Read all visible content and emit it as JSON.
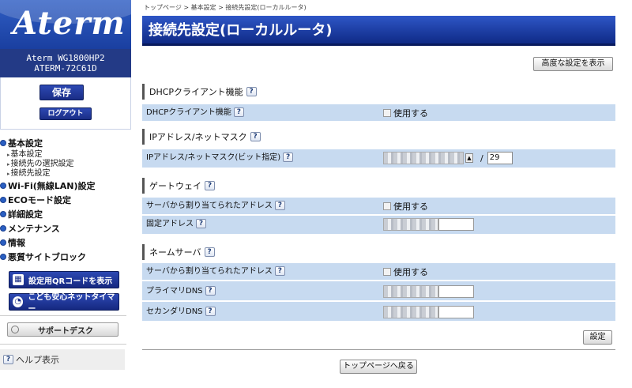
{
  "brand": {
    "logo_text": "Aterm"
  },
  "device": {
    "model": "Aterm WG1800HP2",
    "name": "ATERM-72C61D"
  },
  "buttons": {
    "save": "保存",
    "logout": "ログアウト",
    "advanced": "高度な設定を表示",
    "set": "設定",
    "back_top": "トップページへ戻る",
    "qr": "設定用QRコードを表示",
    "timer": "こども安心ネットタイマー",
    "support": "サポートデスク"
  },
  "nav": {
    "basic": "基本設定",
    "basic_items": [
      "基本設定",
      "接続先の選択設定",
      "接続先設定"
    ],
    "wifi": "Wi-Fi(無線LAN)設定",
    "eco": "ECOモード設定",
    "detail": "詳細設定",
    "maint": "メンテナンス",
    "info": "情報",
    "malicious": "悪質サイトブロック"
  },
  "help": {
    "label": "ヘルプ表示",
    "qm": "?"
  },
  "breadcrumb": "トップページ > 基本設定 > 接続先設定(ローカルルータ)",
  "page_title": "接続先設定(ローカルルータ)",
  "sections": {
    "dhcp": {
      "title": "DHCPクライアント機能",
      "row_label": "DHCPクライアント機能",
      "check_label": "使用する"
    },
    "ip": {
      "title": "IPアドレス/ネットマスク",
      "row_label": "IPアドレス/ネットマスク(ビット指定)",
      "mask_value": "29",
      "slash": "/"
    },
    "gw": {
      "title": "ゲートウェイ",
      "row1_label": "サーバから割り当てられたアドレス",
      "check_label": "使用する",
      "row2_label": "固定アドレス"
    },
    "dns": {
      "title": "ネームサーバ",
      "row1_label": "サーバから割り当てられたアドレス",
      "check_label": "使用する",
      "row2_label": "プライマリDNS",
      "row3_label": "セカンダリDNS"
    }
  }
}
